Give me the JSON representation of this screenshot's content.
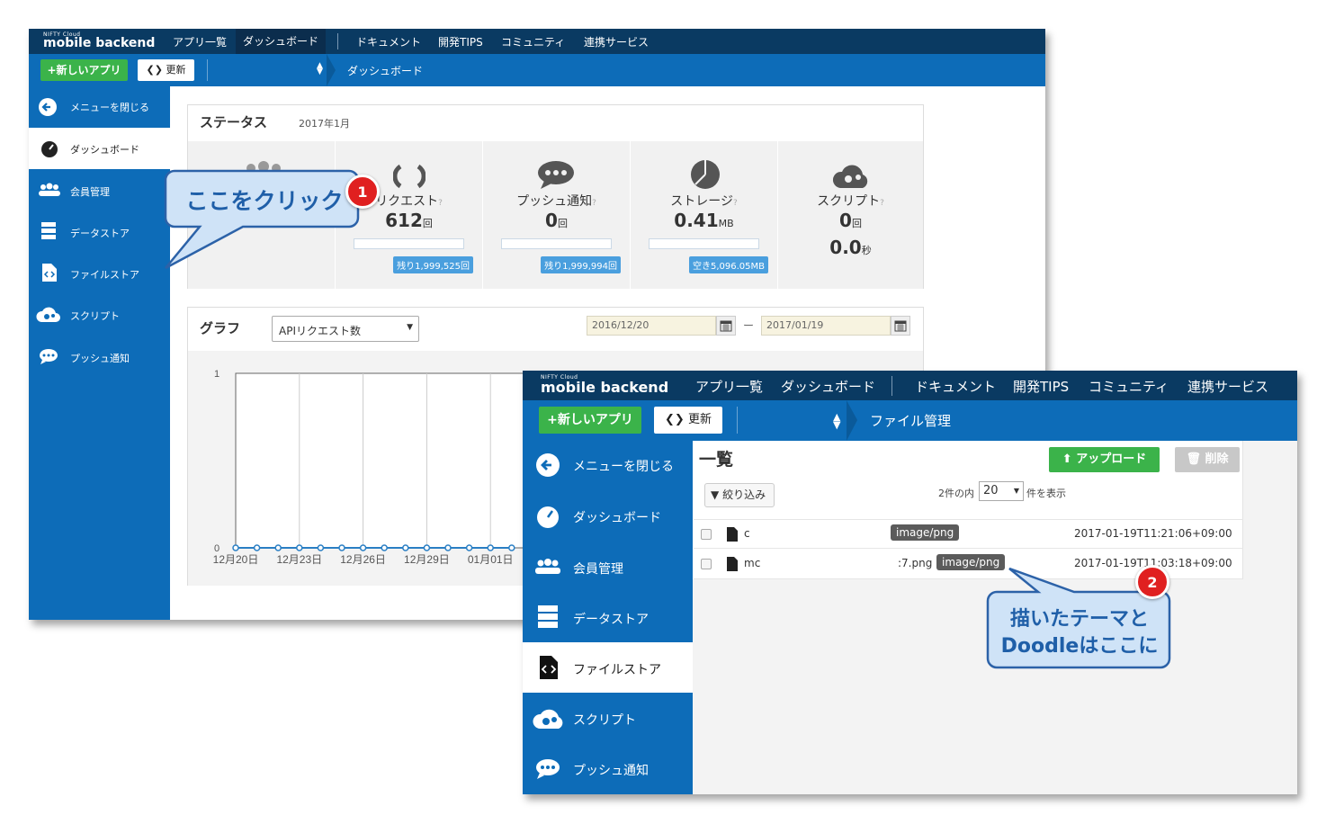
{
  "brand": {
    "small": "NIFTY Cloud",
    "big": "mobile backend"
  },
  "nav": [
    "アプリ一覧",
    "ダッシュボード",
    "ドキュメント",
    "開発TIPS",
    "コミュニティ",
    "連携サービス"
  ],
  "toolbar": {
    "new_app": "+新しいアプリ",
    "refresh": "更新"
  },
  "w1": {
    "crumb": "ダッシュボード",
    "sidebar": [
      "メニューを閉じる",
      "ダッシュボード",
      "会員管理",
      "データストア",
      "ファイルストア",
      "スクリプト",
      "プッシュ通知"
    ],
    "status": {
      "title": "ステータス",
      "month": "2017年1月",
      "cards": [
        {
          "label": "リクエスト",
          "value": "612",
          "unit": "回",
          "tag": "残り1,999,525回"
        },
        {
          "label": "プッシュ通知",
          "value": "0",
          "unit": "回",
          "tag": "残り1,999,994回"
        },
        {
          "label": "ストレージ",
          "value": "0.41",
          "unit": "MB",
          "tag": "空き5,096.05MB"
        },
        {
          "label": "スクリプト",
          "value": "0",
          "unit": "回",
          "value2": "0.0",
          "unit2": "秒"
        }
      ]
    },
    "graph": {
      "title": "グラフ",
      "select": "APIリクエスト数",
      "date_from": "2016/12/20",
      "date_to": "2017/01/19",
      "dash": "ー"
    }
  },
  "chart_data": {
    "type": "line",
    "categories": [
      "12月20日",
      "12月23日",
      "12月26日",
      "12月29日",
      "01月01日"
    ],
    "x": [
      "12月20日",
      "12月21日",
      "12月22日",
      "12月23日",
      "12月24日",
      "12月25日",
      "12月26日",
      "12月27日",
      "12月28日",
      "12月29日",
      "12月30日",
      "12月31日",
      "01月01日",
      "01月02日"
    ],
    "values": [
      0,
      0,
      0,
      0,
      0,
      0,
      0,
      0,
      0,
      0,
      0,
      0,
      0,
      0
    ],
    "ylim": [
      0,
      1
    ],
    "yticks": [
      "1",
      "0"
    ],
    "title": "",
    "xlabel": "",
    "ylabel": "",
    "grid": true
  },
  "w2": {
    "crumb": "ファイル管理",
    "sidebar": [
      "メニューを閉じる",
      "ダッシュボード",
      "会員管理",
      "データストア",
      "ファイルストア",
      "スクリプト",
      "プッシュ通知"
    ],
    "list_title": "一覧",
    "upload": "アップロード",
    "delete": "削除",
    "filter": "絞り込み",
    "count_prefix": "2件の内",
    "per_page": "20",
    "count_suffix": "件を表示",
    "rows": [
      {
        "name": "c",
        "fragment": "",
        "mime": "image/png",
        "date": "2017-01-19T11:21:06+09:00"
      },
      {
        "name": "mc",
        "fragment": ":7.png",
        "mime": "image/png",
        "date": "2017-01-19T11:03:18+09:00"
      }
    ]
  },
  "callout1": {
    "text": "ここをクリック",
    "badge": "1"
  },
  "callout2": {
    "line1": "描いたテーマと",
    "line2": "Doodleはここに",
    "badge": "2"
  },
  "colors": {
    "nav": "#0a3a62",
    "bar": "#0d6cb8",
    "green": "#3bb34a",
    "callout_fill": "#cfe3f7",
    "callout_border": "#2c62a8",
    "badge": "#e02020"
  }
}
